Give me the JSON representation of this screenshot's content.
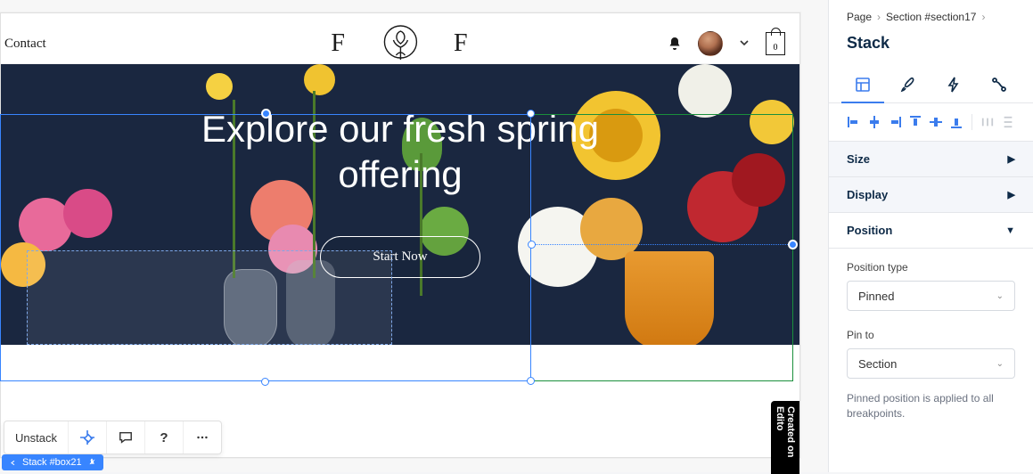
{
  "breadcrumb": {
    "root": "Page",
    "section": "Section #section17"
  },
  "panel": {
    "title": "Stack",
    "sections": {
      "size": "Size",
      "display": "Display",
      "position": "Position"
    },
    "position": {
      "type_label": "Position type",
      "type_value": "Pinned",
      "pin_to_label": "Pin to",
      "pin_to_value": "Section",
      "hint": "Pinned position is applied to all breakpoints."
    }
  },
  "canvas": {
    "nav_contact": "Contact",
    "logo_letter": "F",
    "bag_count": "0",
    "hero_title_line1": "Explore our fresh spring",
    "hero_title_line2": "offering",
    "hero_cta": "Start Now",
    "created_tag": "Created on Edito"
  },
  "toolbar": {
    "unstack": "Unstack"
  },
  "bottom_tag": {
    "label": "Stack #box21"
  }
}
